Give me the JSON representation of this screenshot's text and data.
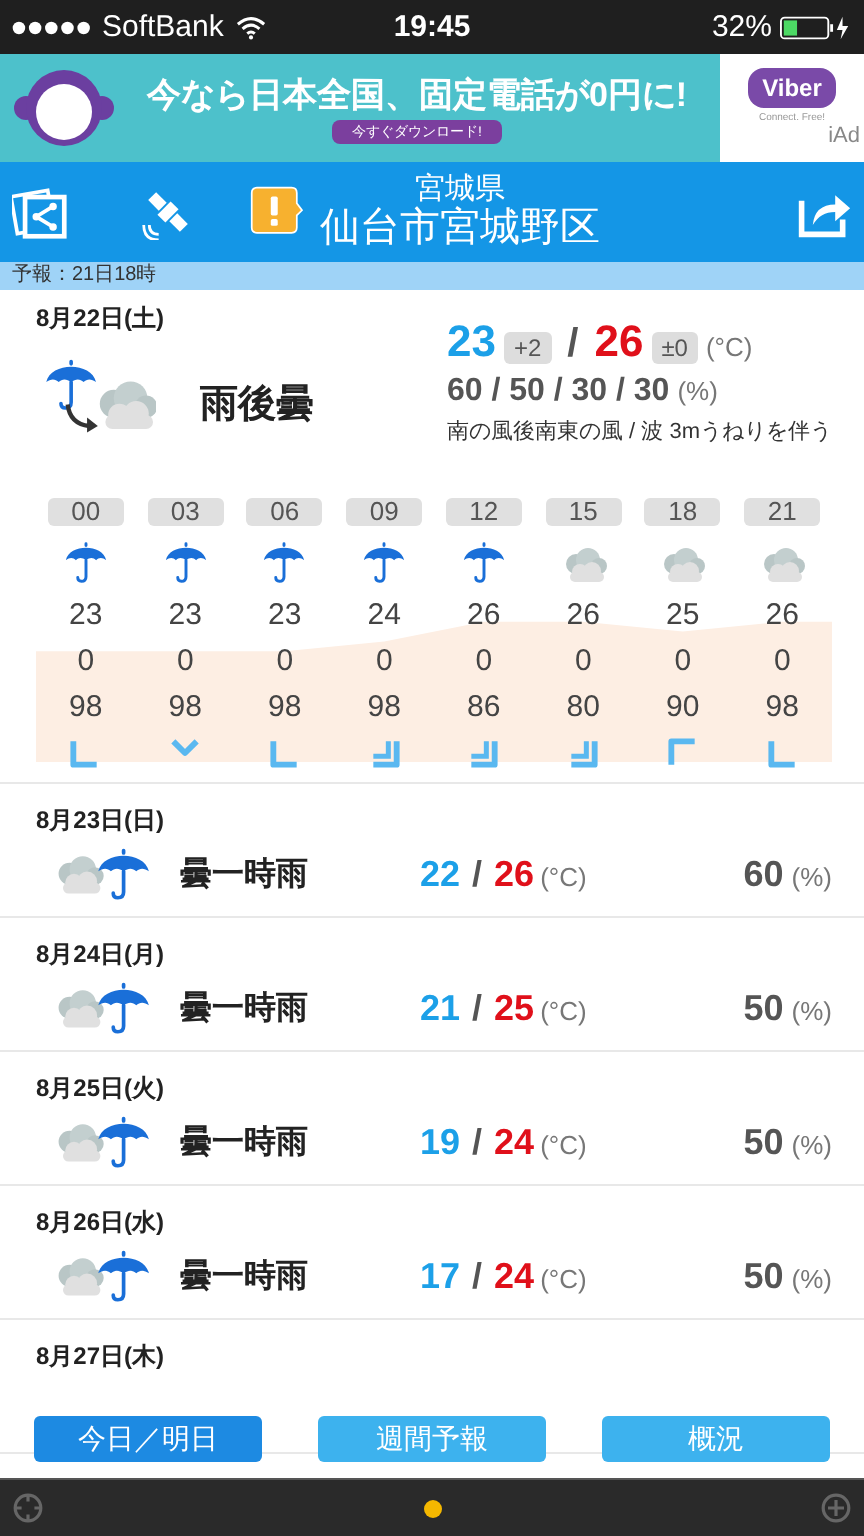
{
  "status_bar": {
    "carrier": "SoftBank",
    "time": "19:45",
    "battery_text": "32%"
  },
  "ad": {
    "headline": "今なら日本全国、固定電話が0円に!",
    "cta": "今すぐダウンロード!",
    "brand": "Viber",
    "tagline": "Connect. Free!",
    "network": "iAd"
  },
  "header": {
    "prefecture": "宮城県",
    "city": "仙台市宮城野区"
  },
  "issued": "予報：21日18時",
  "today": {
    "date": "8月22日(土)",
    "icon": {
      "kind": "rain-then-cloud"
    },
    "condition": "雨後曇",
    "low": "23",
    "low_diff": "+2",
    "separator": "/",
    "high": "26",
    "high_diff": "±0",
    "temp_unit": "(°C)",
    "precip": "60 / 50 / 30 / 30",
    "precip_unit": "(%)",
    "wind_wave": "南の風後南東の風 / 波 3mうねりを伴う"
  },
  "hourly": [
    {
      "hour": "00",
      "kind": "rain",
      "temp": "23",
      "precip": "0",
      "humidity": "98",
      "wind": {
        "kind": "south",
        "strong": false
      }
    },
    {
      "hour": "03",
      "kind": "rain",
      "temp": "23",
      "precip": "0",
      "humidity": "98",
      "wind": {
        "kind": "southeast",
        "strong": false
      }
    },
    {
      "hour": "06",
      "kind": "rain",
      "temp": "23",
      "precip": "0",
      "humidity": "98",
      "wind": {
        "kind": "south",
        "strong": false
      }
    },
    {
      "hour": "09",
      "kind": "rain",
      "temp": "24",
      "precip": "0",
      "humidity": "98",
      "wind": {
        "kind": "east",
        "strong": true
      }
    },
    {
      "hour": "12",
      "kind": "rain",
      "temp": "26",
      "precip": "0",
      "humidity": "86",
      "wind": {
        "kind": "east",
        "strong": true
      }
    },
    {
      "hour": "15",
      "kind": "cloud",
      "temp": "26",
      "precip": "0",
      "humidity": "80",
      "wind": {
        "kind": "east",
        "strong": true
      }
    },
    {
      "hour": "18",
      "kind": "cloud",
      "temp": "25",
      "precip": "0",
      "humidity": "90",
      "wind": {
        "kind": "northeast",
        "strong": false
      }
    },
    {
      "hour": "21",
      "kind": "cloud",
      "temp": "26",
      "precip": "0",
      "humidity": "98",
      "wind": {
        "kind": "south",
        "strong": false
      }
    }
  ],
  "days": [
    {
      "date": "8月23日(日)",
      "kind": "cloud-rain",
      "condition": "曇一時雨",
      "low": "22",
      "separator": "/",
      "high": "26",
      "temp_unit": "(°C)",
      "precip": "60",
      "precip_unit": "(%)"
    },
    {
      "date": "8月24日(月)",
      "kind": "cloud-rain",
      "condition": "曇一時雨",
      "low": "21",
      "separator": "/",
      "high": "25",
      "temp_unit": "(°C)",
      "precip": "50",
      "precip_unit": "(%)"
    },
    {
      "date": "8月25日(火)",
      "kind": "cloud-rain",
      "condition": "曇一時雨",
      "low": "19",
      "separator": "/",
      "high": "24",
      "temp_unit": "(°C)",
      "precip": "50",
      "precip_unit": "(%)"
    },
    {
      "date": "8月26日(水)",
      "kind": "cloud-rain",
      "condition": "曇一時雨",
      "low": "17",
      "separator": "/",
      "high": "24",
      "temp_unit": "(°C)",
      "precip": "50",
      "precip_unit": "(%)"
    },
    {
      "date": "8月27日(木)"
    }
  ],
  "tabs": [
    {
      "label": "今日／明日",
      "selected": true
    },
    {
      "label": "週間予報",
      "selected": false
    },
    {
      "label": "概況",
      "selected": false
    }
  ]
}
